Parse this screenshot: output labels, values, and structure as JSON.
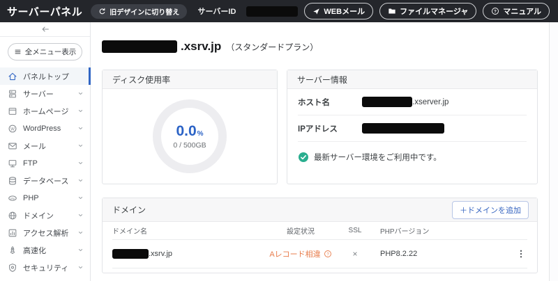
{
  "header": {
    "logo": "サーバーパネル",
    "switch_design_label": "旧デザインに切り替え",
    "server_id_label": "サーバーID",
    "webmail_label": "WEBメール",
    "file_manager_label": "ファイルマネージャ",
    "manual_label": "マニュアル"
  },
  "sidebar": {
    "menu_toggle_label": "全メニュー表示",
    "items": [
      {
        "label": "パネルトップ",
        "icon": "home-icon",
        "active": true
      },
      {
        "label": "サーバー",
        "icon": "server-icon"
      },
      {
        "label": "ホームページ",
        "icon": "browser-icon"
      },
      {
        "label": "WordPress",
        "icon": "wordpress-icon"
      },
      {
        "label": "メール",
        "icon": "mail-icon"
      },
      {
        "label": "FTP",
        "icon": "monitor-icon"
      },
      {
        "label": "データベース",
        "icon": "database-icon"
      },
      {
        "label": "PHP",
        "icon": "php-icon"
      },
      {
        "label": "ドメイン",
        "icon": "globe-icon"
      },
      {
        "label": "アクセス解析",
        "icon": "chart-icon"
      },
      {
        "label": "高速化",
        "icon": "rocket-icon"
      },
      {
        "label": "セキュリティ",
        "icon": "shield-icon"
      }
    ]
  },
  "main": {
    "title": {
      "domain_suffix": ".xsrv.jp",
      "plan": "（スタンダードプラン）"
    },
    "disk_card": {
      "title": "ディスク使用率",
      "percent": "0.0",
      "percent_unit": "%",
      "usage": "0 / 500GB"
    },
    "server_card": {
      "title": "サーバー情報",
      "host_label": "ホスト名",
      "host_suffix": ".xserver.jp",
      "ip_label": "IPアドレス",
      "status_message": "最新サーバー環境をご利用中です。"
    },
    "domain_card": {
      "title": "ドメイン",
      "add_button_label": "＋ドメインを追加",
      "table": {
        "headers": [
          "ドメイン名",
          "設定状況",
          "SSL",
          "PHPバージョン"
        ],
        "rows": [
          {
            "domain_suffix": ".xsrv.jp",
            "status": "Aレコード相違",
            "ssl": "×",
            "php_version": "PHP8.2.22"
          }
        ]
      }
    }
  },
  "colors": {
    "header_bg": "#24262b",
    "accent_blue": "#3166c4",
    "status_orange": "#e87c4b",
    "status_green": "#2aae8f"
  }
}
